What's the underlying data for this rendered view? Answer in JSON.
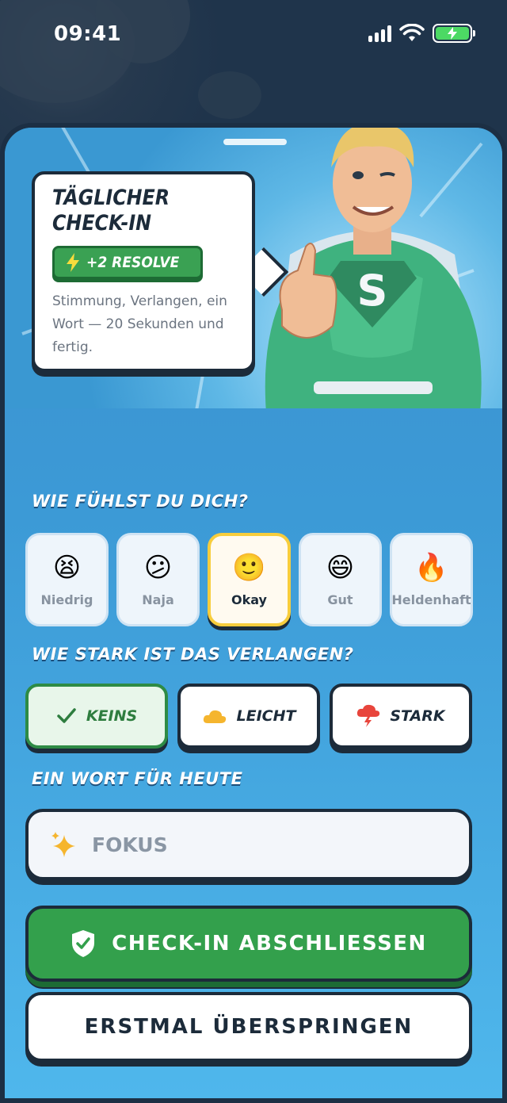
{
  "status": {
    "time": "09:41"
  },
  "intro": {
    "title": "TÄGLICHER CHECK-IN",
    "reward": "+2 RESOLVE",
    "description": "Stimmung, Verlangen, ein Wort — 20 Sekunden und fertig."
  },
  "mood": {
    "heading": "WIE FÜHLST DU DICH?",
    "selected": "Okay",
    "options": [
      {
        "emoji": "😫",
        "label": "Niedrig"
      },
      {
        "emoji": "😕",
        "label": "Naja"
      },
      {
        "emoji": "🙂",
        "label": "Okay"
      },
      {
        "emoji": "😄",
        "label": "Gut"
      },
      {
        "emoji": "🔥",
        "label": "Heldenhaft"
      }
    ]
  },
  "craving": {
    "heading": "WIE STARK IST DAS VERLANGEN?",
    "selected": "KEINS",
    "options": [
      {
        "icon": "check-icon",
        "label": "KEINS"
      },
      {
        "icon": "cloud-icon",
        "label": "LEICHT"
      },
      {
        "icon": "storm-cloud-icon",
        "label": "STARK"
      }
    ]
  },
  "word": {
    "heading": "EIN WORT FÜR HEUTE",
    "placeholder": "FOKUS"
  },
  "actions": {
    "complete": "CHECK-IN ABSCHLIESSEN",
    "skip": "ERSTMAL ÜBERSPRINGEN"
  },
  "colors": {
    "accent_green": "#33a04c",
    "selected_yellow": "#f7cd3d",
    "ink": "#1c2b3a"
  }
}
